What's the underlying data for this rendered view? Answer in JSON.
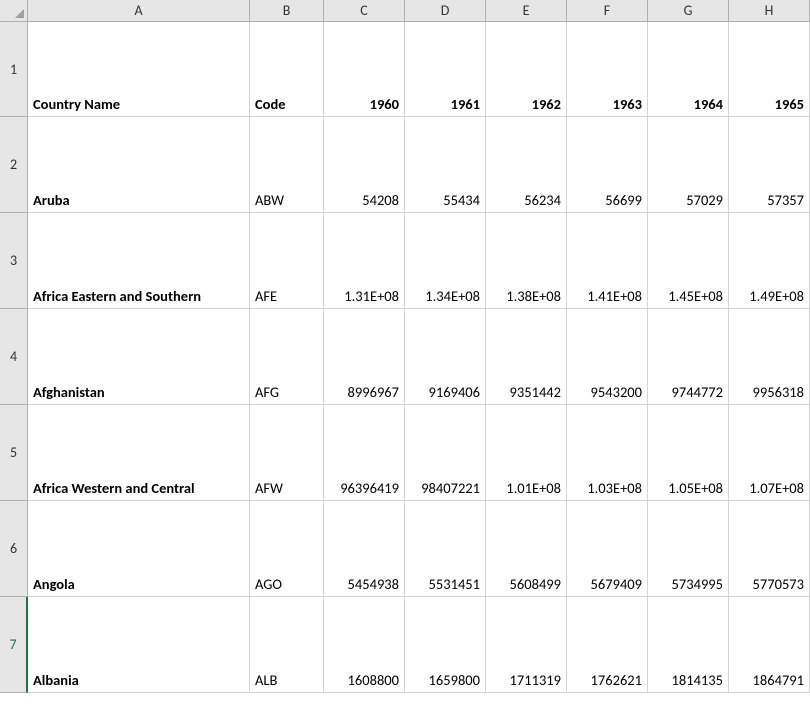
{
  "columns": [
    "A",
    "B",
    "C",
    "D",
    "E",
    "F",
    "G",
    "H"
  ],
  "rowNumbers": [
    "1",
    "2",
    "3",
    "4",
    "5",
    "6",
    "7"
  ],
  "headers": {
    "col_a": "Country Name",
    "col_b": "Code",
    "col_c": "1960",
    "col_d": "1961",
    "col_e": "1962",
    "col_f": "1963",
    "col_g": "1964",
    "col_h": "1965"
  },
  "rows": [
    {
      "country": "Aruba",
      "code": "ABW",
      "y1960": "54208",
      "y1961": "55434",
      "y1962": "56234",
      "y1963": "56699",
      "y1964": "57029",
      "y1965": "57357"
    },
    {
      "country": "Africa Eastern and Southern",
      "code": "AFE",
      "y1960": "1.31E+08",
      "y1961": "1.34E+08",
      "y1962": "1.38E+08",
      "y1963": "1.41E+08",
      "y1964": "1.45E+08",
      "y1965": "1.49E+08"
    },
    {
      "country": "Afghanistan",
      "code": "AFG",
      "y1960": "8996967",
      "y1961": "9169406",
      "y1962": "9351442",
      "y1963": "9543200",
      "y1964": "9744772",
      "y1965": "9956318"
    },
    {
      "country": "Africa Western and Central",
      "code": "AFW",
      "y1960": "96396419",
      "y1961": "98407221",
      "y1962": "1.01E+08",
      "y1963": "1.03E+08",
      "y1964": "1.05E+08",
      "y1965": "1.07E+08"
    },
    {
      "country": "Angola",
      "code": "AGO",
      "y1960": "5454938",
      "y1961": "5531451",
      "y1962": "5608499",
      "y1963": "5679409",
      "y1964": "5734995",
      "y1965": "5770573"
    },
    {
      "country": "Albania",
      "code": "ALB",
      "y1960": "1608800",
      "y1961": "1659800",
      "y1962": "1711319",
      "y1963": "1762621",
      "y1964": "1814135",
      "y1965": "1864791"
    }
  ]
}
